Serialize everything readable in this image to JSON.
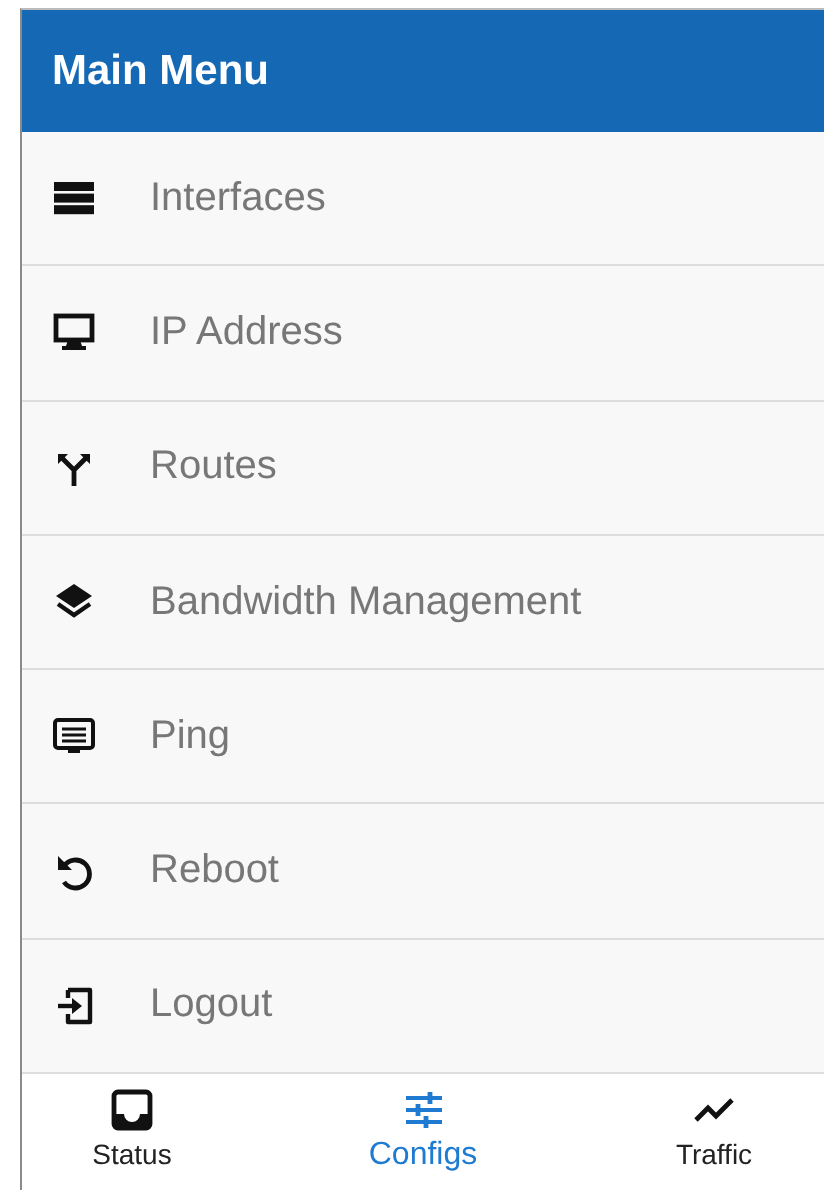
{
  "header": {
    "title": "Main Menu"
  },
  "menu": [
    {
      "kind": "interfaces",
      "label": "Interfaces"
    },
    {
      "kind": "ip",
      "label": "IP Address"
    },
    {
      "kind": "routes",
      "label": "Routes"
    },
    {
      "kind": "bandwidth",
      "label": "Bandwidth Management"
    },
    {
      "kind": "ping",
      "label": "Ping"
    },
    {
      "kind": "reboot",
      "label": "Reboot"
    },
    {
      "kind": "logout",
      "label": "Logout"
    }
  ],
  "bottom_nav": [
    {
      "kind": "status",
      "label": "Status",
      "selected": false
    },
    {
      "kind": "configs",
      "label": "Configs",
      "selected": true
    },
    {
      "kind": "traffic",
      "label": "Traffic",
      "selected": false
    }
  ]
}
